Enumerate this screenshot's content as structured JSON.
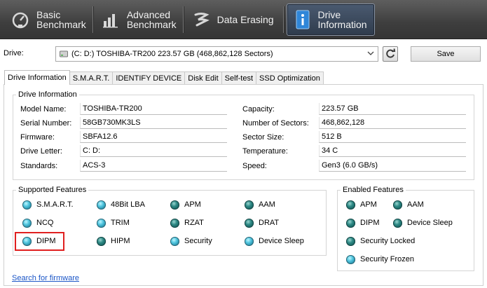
{
  "nav": {
    "items": [
      {
        "label_line1": "Basic",
        "label_line2": "Benchmark",
        "icon": "speedometer-icon"
      },
      {
        "label_line1": "Advanced",
        "label_line2": "Benchmark",
        "icon": "bar-chart-icon"
      },
      {
        "label_line1": "Data Erasing",
        "label_line2": "",
        "icon": "eraser-icon"
      },
      {
        "label_line1": "Drive",
        "label_line2": "Information",
        "icon": "drive-info-icon"
      }
    ]
  },
  "drive": {
    "label": "Drive:",
    "selected": "(C: D:) TOSHIBA-TR200  223.57 GB (468,862,128 Sectors)"
  },
  "toolbar": {
    "save_label": "Save"
  },
  "tabs": [
    "Drive Information",
    "S.M.A.R.T.",
    "IDENTIFY DEVICE",
    "Disk Edit",
    "Self-test",
    "SSD Optimization"
  ],
  "drive_info": {
    "title": "Drive Information",
    "left": [
      {
        "label": "Model Name:",
        "value": "TOSHIBA-TR200"
      },
      {
        "label": "Serial Number:",
        "value": "58GB730MK3LS"
      },
      {
        "label": "Firmware:",
        "value": "SBFA12.6"
      },
      {
        "label": "Drive Letter:",
        "value": "C: D:"
      },
      {
        "label": "Standards:",
        "value": "ACS-3"
      }
    ],
    "right": [
      {
        "label": "Capacity:",
        "value": "223.57 GB"
      },
      {
        "label": "Number of Sectors:",
        "value": "468,862,128"
      },
      {
        "label": "Sector Size:",
        "value": "512 B"
      },
      {
        "label": "Temperature:",
        "value": "34 C"
      },
      {
        "label": "Speed:",
        "value": "Gen3 (6.0 GB/s)"
      }
    ]
  },
  "supported": {
    "title": "Supported Features",
    "items": [
      {
        "label": "S.M.A.R.T.",
        "state": "on"
      },
      {
        "label": "48Bit LBA",
        "state": "on"
      },
      {
        "label": "APM",
        "state": "off"
      },
      {
        "label": "AAM",
        "state": "off"
      },
      {
        "label": "NCQ",
        "state": "on"
      },
      {
        "label": "TRIM",
        "state": "on"
      },
      {
        "label": "RZAT",
        "state": "off"
      },
      {
        "label": "DRAT",
        "state": "off"
      },
      {
        "label": "DIPM",
        "state": "on"
      },
      {
        "label": "HIPM",
        "state": "off"
      },
      {
        "label": "Security",
        "state": "on"
      },
      {
        "label": "Device Sleep",
        "state": "on"
      }
    ]
  },
  "enabled": {
    "title": "Enabled Features",
    "items": [
      {
        "label": "APM",
        "state": "off"
      },
      {
        "label": "AAM",
        "state": "off"
      },
      {
        "label": "DIPM",
        "state": "off"
      },
      {
        "label": "Device Sleep",
        "state": "off"
      },
      {
        "label": "Security Locked",
        "state": "off"
      },
      {
        "label": "Security Frozen",
        "state": "on"
      }
    ]
  },
  "link": {
    "label": "Search for firmware"
  }
}
